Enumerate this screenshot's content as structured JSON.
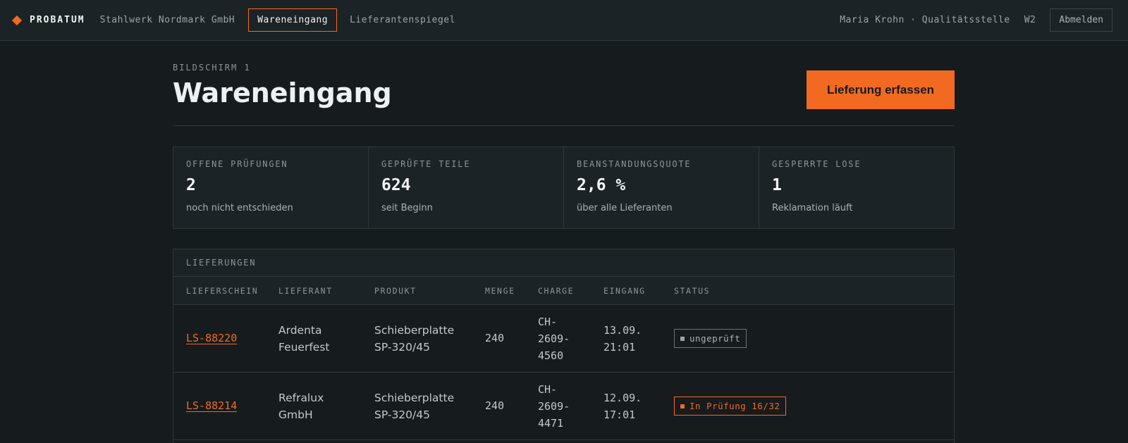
{
  "header": {
    "brand": "PROBATUM",
    "company": "Stahlwerk Nordmark GmbH",
    "tabs": [
      {
        "label": "Wareneingang",
        "active": true
      },
      {
        "label": "Lieferantenspiegel",
        "active": false
      }
    ],
    "user": "Maria Krohn · Qualitätsstelle",
    "workstation": "W2",
    "logout_label": "Abmelden"
  },
  "page": {
    "eyebrow": "BILDSCHIRM 1",
    "title": "Wareneingang",
    "primary_action": "Lieferung erfassen"
  },
  "stats": [
    {
      "label": "OFFENE PRÜFUNGEN",
      "value": "2",
      "sub": "noch nicht entschieden"
    },
    {
      "label": "GEPRÜFTE TEILE",
      "value": "624",
      "sub": "seit Beginn"
    },
    {
      "label": "BEANSTANDUNGSQUOTE",
      "value": "2,6 %",
      "sub": "über alle Lieferanten"
    },
    {
      "label": "GESPERRTE LOSE",
      "value": "1",
      "sub": "Reklamation läuft"
    }
  ],
  "deliveries": {
    "caption": "LIEFERUNGEN",
    "columns": [
      "LIEFERSCHEIN",
      "LIEFERANT",
      "PRODUKT",
      "MENGE",
      "CHARGE",
      "EINGANG",
      "STATUS"
    ],
    "rows": [
      {
        "lieferschein": "LS-88220",
        "lieferant_l1": "Ardenta",
        "lieferant_l2": "Feuerfest",
        "produkt_l1": "Schieberplatte",
        "produkt_l2": "SP-320/45",
        "menge": "240",
        "charge_l1": "CH-",
        "charge_l2": "2609-",
        "charge_l3": "4560",
        "eingang_l1": "13.09.",
        "eingang_l2": "21:01",
        "status": "ungeprüft"
      },
      {
        "lieferschein": "LS-88214",
        "lieferant_l1": "Refralux",
        "lieferant_l2": "GmbH",
        "produkt_l1": "Schieberplatte",
        "produkt_l2": "SP-320/45",
        "menge": "240",
        "charge_l1": "CH-",
        "charge_l2": "2609-",
        "charge_l3": "4471",
        "eingang_l1": "12.09.",
        "eingang_l2": "17:01",
        "status": "In Prüfung 16/32"
      }
    ]
  },
  "colors": {
    "accent": "#f26a22",
    "background": "#161b1d",
    "surface": "#1c2326"
  }
}
